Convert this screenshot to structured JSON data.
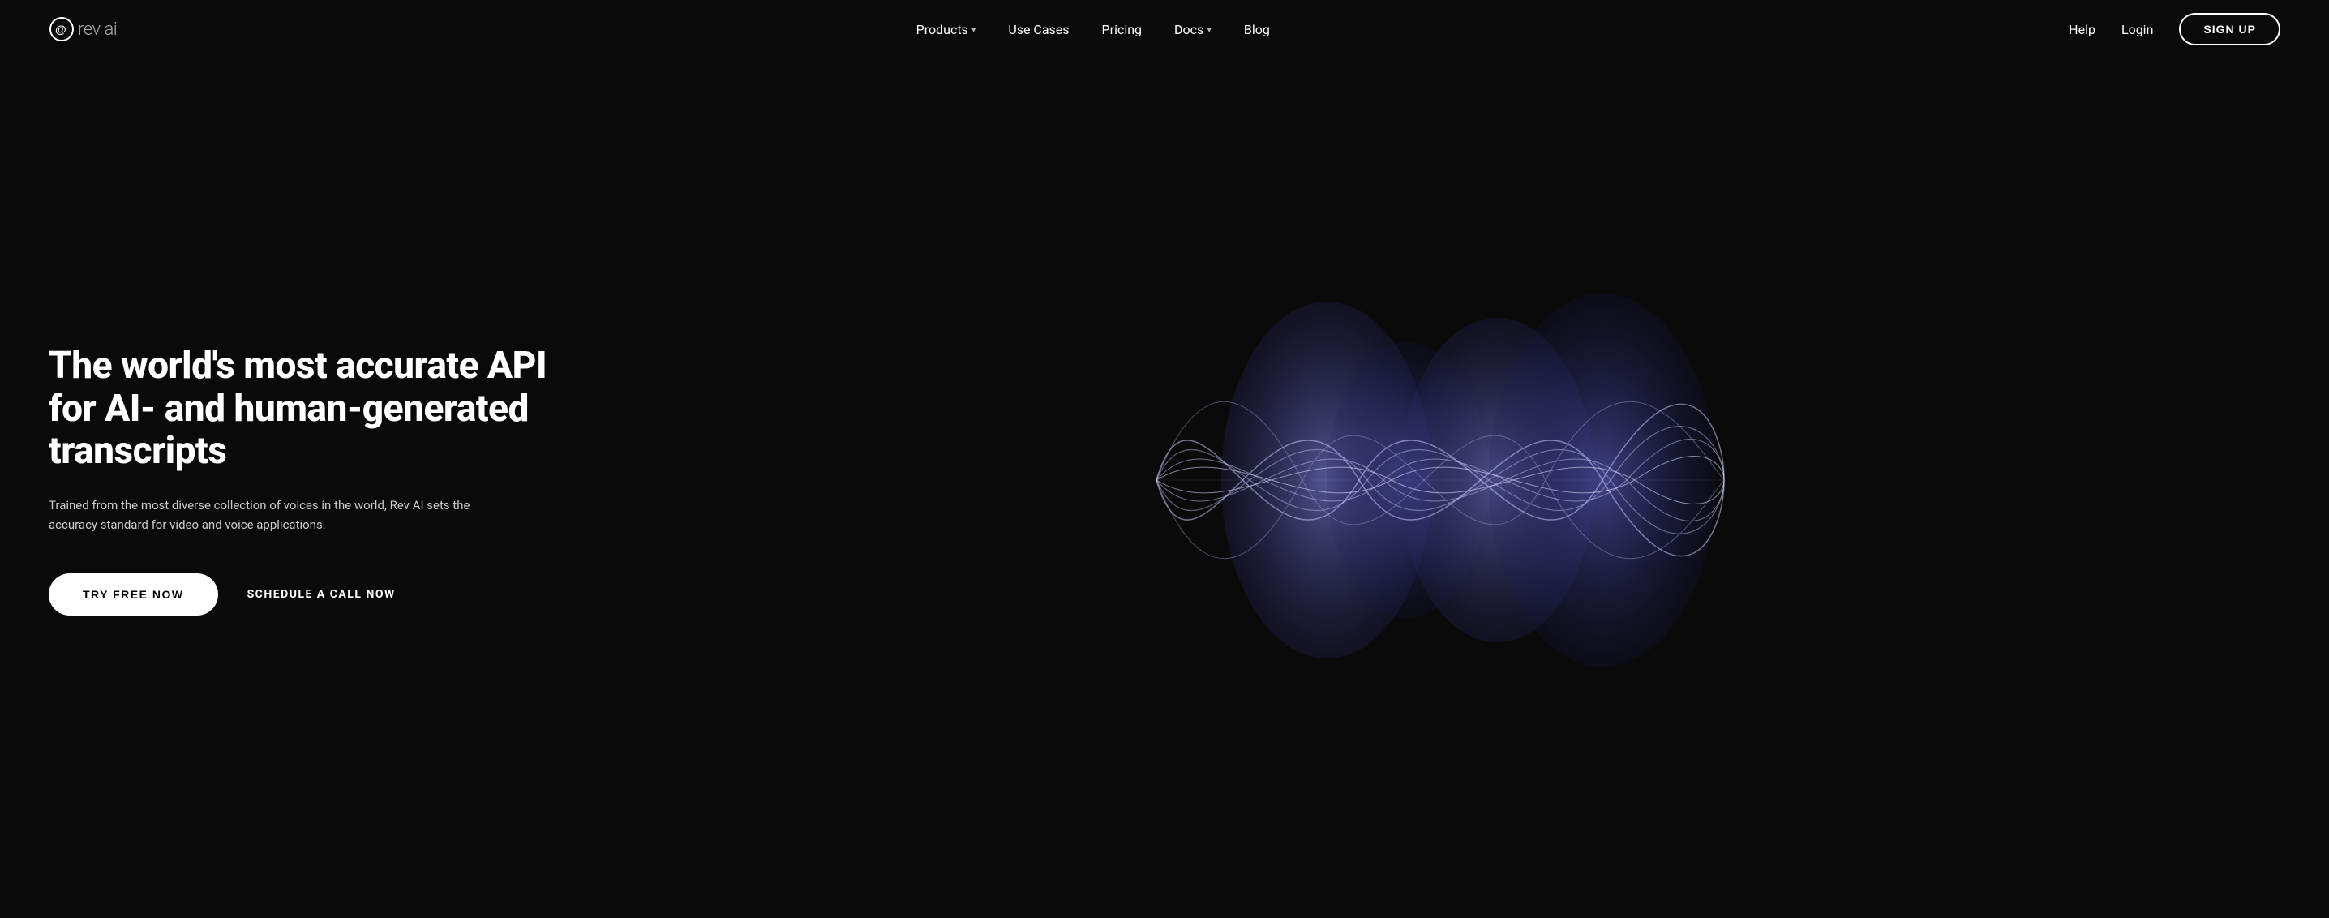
{
  "logo": {
    "brand_name": "rev",
    "brand_suffix": "ai",
    "aria_label": "Rev AI Logo"
  },
  "nav": {
    "center_links": [
      {
        "label": "Products",
        "has_dropdown": true
      },
      {
        "label": "Use Cases",
        "has_dropdown": false
      },
      {
        "label": "Pricing",
        "has_dropdown": false
      },
      {
        "label": "Docs",
        "has_dropdown": true
      },
      {
        "label": "Blog",
        "has_dropdown": false
      }
    ],
    "right_links": [
      {
        "label": "Help"
      },
      {
        "label": "Login"
      }
    ],
    "signup_label": "SIGN UP"
  },
  "hero": {
    "title": "The world's most accurate API for AI- and human-generated transcripts",
    "description": "Trained from the most diverse collection of voices in the world, Rev AI sets the accuracy standard for video and voice applications.",
    "btn_try_free": "TRY FREE NOW",
    "btn_schedule": "SCHEDULE A CALL NOW"
  },
  "colors": {
    "background": "#0a0a0a",
    "wave_purple_1": "#5a5aaa",
    "wave_purple_2": "#3d3d8f",
    "wave_line": "rgba(200,200,255,0.6)"
  }
}
